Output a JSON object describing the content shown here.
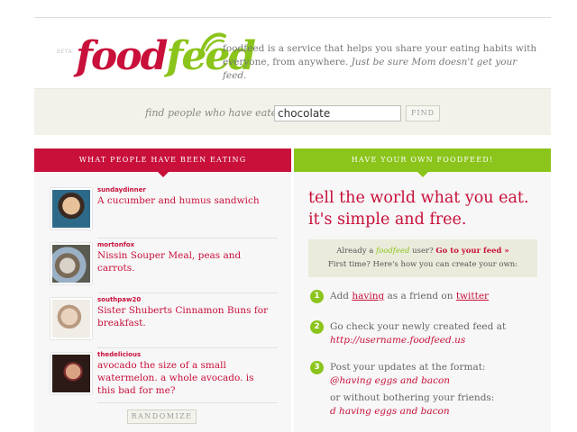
{
  "header": {
    "beta_label": "BETA",
    "logo_food": "food",
    "logo_feed": "feed",
    "tagline_prefix": "foodfeed is a service that helps you share your eating habits with everyone, from anywhere.",
    "tagline_em": "Just be sure Mom doesn't get your feed."
  },
  "search": {
    "label": "find people who have eaten",
    "value": "chocolate",
    "button_label": "FIND"
  },
  "left": {
    "title": "WHAT PEOPLE HAVE BEEN EATING",
    "items": [
      {
        "user": "sundaydinner",
        "text": "A cucumber and humus sandwich"
      },
      {
        "user": "mortonfox",
        "text": "Nissin Souper Meal, peas and carrots."
      },
      {
        "user": "southpaw20",
        "text": "Sister Shuberts Cinnamon Buns for breakfast."
      },
      {
        "user": "thedelicious",
        "text": "avocado the size of a small watermelon. a whole avocado. is this bad for me?"
      }
    ],
    "randomize_label": "RANDOMIZE"
  },
  "right": {
    "title": "HAVE YOUR OWN FOODFEED!",
    "headline": "tell the world what you eat. it's simple and free.",
    "info": {
      "already_prefix": "Already a",
      "already_brand": "foodfeed",
      "already_suffix": "user?",
      "go_link": "Go to your feed »",
      "first_time": "First time? Here's how you can create your own:"
    },
    "steps": [
      {
        "num": "1",
        "add": "Add",
        "having": "having",
        "mid": "as a friend on",
        "twitter": "twitter"
      },
      {
        "num": "2",
        "text": "Go check your newly created feed at",
        "url": "http://username.foodfeed.us"
      },
      {
        "num": "3",
        "text": "Post your updates at the format:",
        "example1": "@having eggs and bacon",
        "alt": "or without bothering your friends:",
        "example2": "d having eggs and bacon"
      }
    ]
  },
  "colors": {
    "brand_red": "#c8103a",
    "brand_green": "#8bc41b",
    "search_band": "#f2f2ea"
  }
}
